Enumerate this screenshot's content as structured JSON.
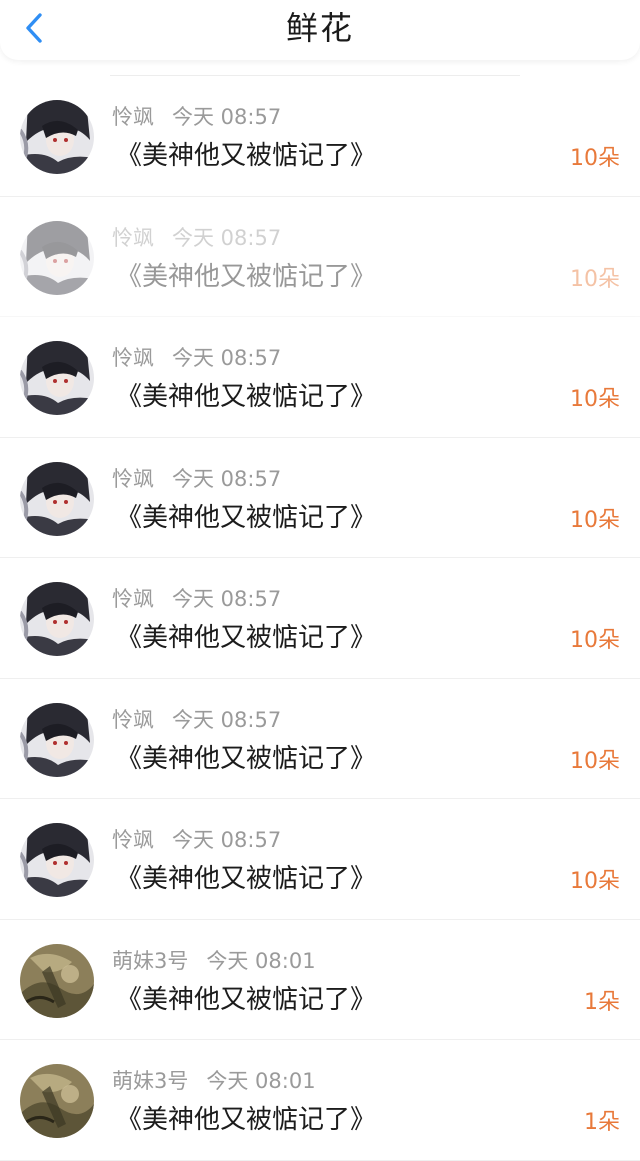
{
  "header": {
    "title": "鲜花"
  },
  "colors": {
    "accent_blue": "#2f8ef4",
    "count_orange": "#e8793a",
    "meta_gray": "#9a9a9a"
  },
  "rows": [
    {
      "user": "怜飒",
      "time": "今天 08:57",
      "book": "《美神他又被惦记了》",
      "count": "10朵",
      "avatar": "dark-hair-avatar",
      "faded": false
    },
    {
      "user": "怜飒",
      "time": "今天 08:57",
      "book": "《美神他又被惦记了》",
      "count": "10朵",
      "avatar": "dark-hair-avatar",
      "faded": true
    },
    {
      "user": "怜飒",
      "time": "今天 08:57",
      "book": "《美神他又被惦记了》",
      "count": "10朵",
      "avatar": "dark-hair-avatar",
      "faded": false
    },
    {
      "user": "怜飒",
      "time": "今天 08:57",
      "book": "《美神他又被惦记了》",
      "count": "10朵",
      "avatar": "dark-hair-avatar",
      "faded": false
    },
    {
      "user": "怜飒",
      "time": "今天 08:57",
      "book": "《美神他又被惦记了》",
      "count": "10朵",
      "avatar": "dark-hair-avatar",
      "faded": false
    },
    {
      "user": "怜飒",
      "time": "今天 08:57",
      "book": "《美神他又被惦记了》",
      "count": "10朵",
      "avatar": "dark-hair-avatar",
      "faded": false
    },
    {
      "user": "怜飒",
      "time": "今天 08:57",
      "book": "《美神他又被惦记了》",
      "count": "10朵",
      "avatar": "dark-hair-avatar",
      "faded": false
    },
    {
      "user": "萌妹3号",
      "time": "今天 08:01",
      "book": "《美神他又被惦记了》",
      "count": "1朵",
      "avatar": "sepia-sketch-avatar",
      "faded": false
    },
    {
      "user": "萌妹3号",
      "time": "今天 08:01",
      "book": "《美神他又被惦记了》",
      "count": "1朵",
      "avatar": "sepia-sketch-avatar",
      "faded": false
    }
  ]
}
